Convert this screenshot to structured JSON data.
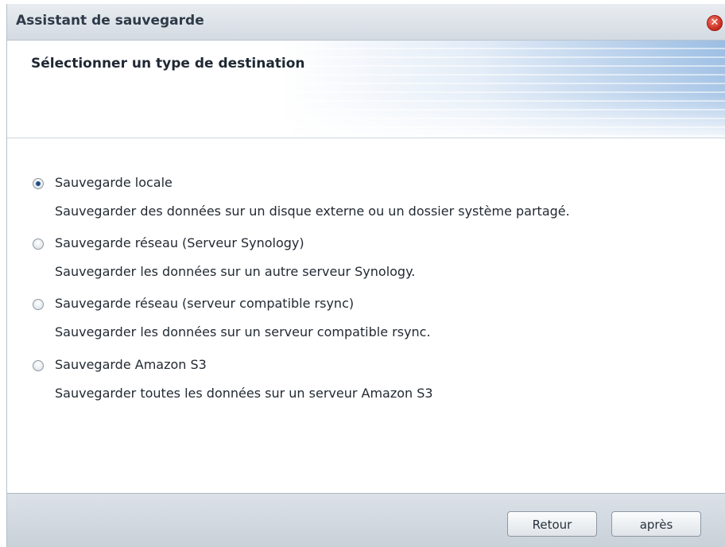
{
  "window": {
    "title": "Assistant de sauvegarde",
    "close_glyph": "✕"
  },
  "header": {
    "step_title": "Sélectionner un type de destination"
  },
  "options": [
    {
      "label": "Sauvegarde locale",
      "description": "Sauvegarder des données sur un disque externe ou un dossier système partagé.",
      "selected": true
    },
    {
      "label": "Sauvegarde réseau (Serveur Synology)",
      "description": "Sauvegarder les données sur un autre serveur Synology.",
      "selected": false
    },
    {
      "label": "Sauvegarde réseau (serveur compatible rsync)",
      "description": "Sauvegarder les données sur un serveur compatible rsync.",
      "selected": false
    },
    {
      "label": "Sauvegarde Amazon S3",
      "description": "Sauvegarder toutes les données sur un serveur Amazon S3",
      "selected": false
    }
  ],
  "footer": {
    "back_label": "Retour",
    "next_label": "après"
  },
  "icons": {
    "close": "close-icon",
    "radio": "radio-button-icon"
  },
  "colors": {
    "close_button": "#c8271b",
    "radio_dot": "#1f4e86",
    "header_accent": "#96bae2"
  }
}
